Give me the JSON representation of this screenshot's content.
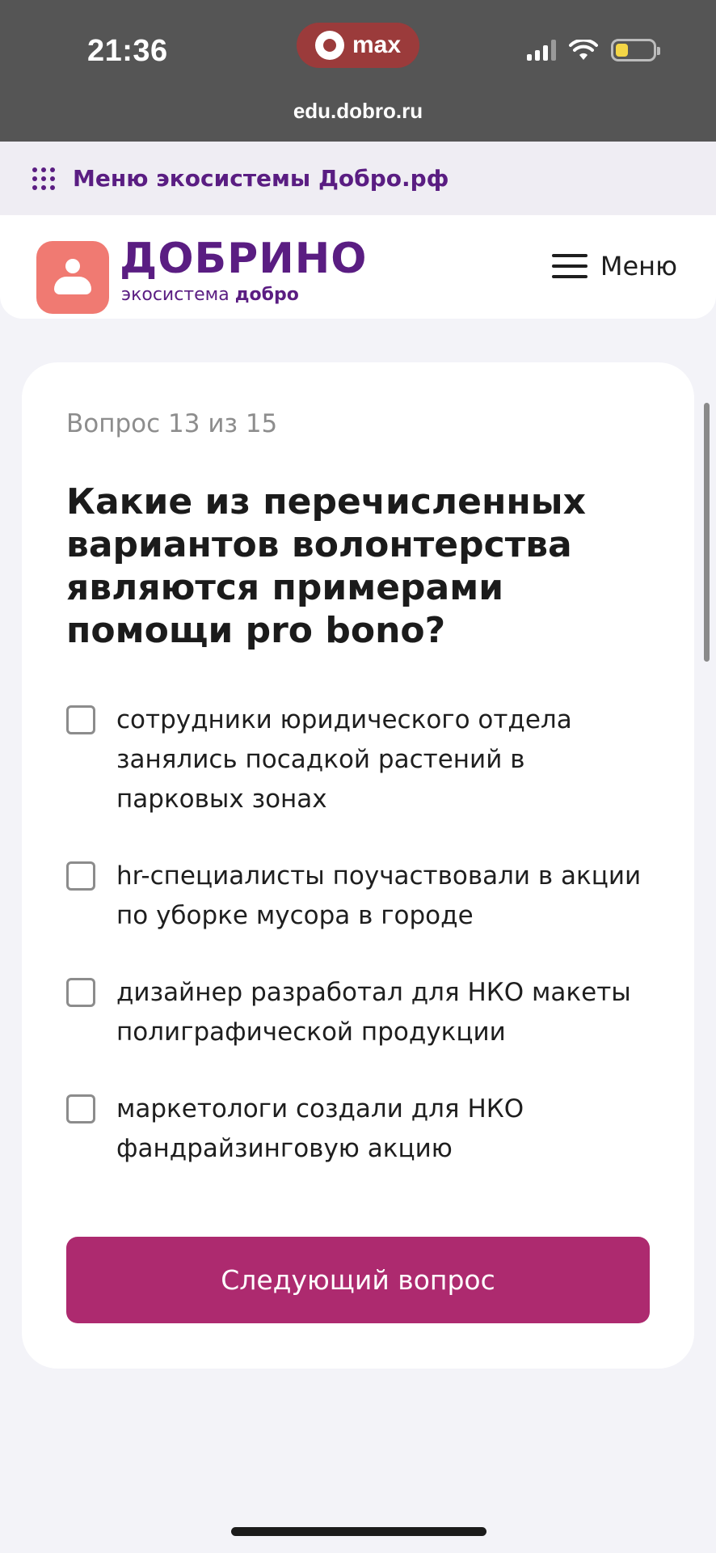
{
  "status_bar": {
    "time": "21:36",
    "app_pill": "max",
    "icons": [
      "signal-icon",
      "wifi-icon",
      "battery-icon"
    ],
    "battery_level": 0.35
  },
  "browser": {
    "url": "edu.dobro.ru"
  },
  "eco_menu": {
    "label": "Меню экосистемы Добро.рф",
    "icon": "grid-dots-icon"
  },
  "header": {
    "brand": "ДОБРИНО",
    "subtitle_prefix": "экосистема ",
    "subtitle_brand": "добро",
    "menu_label": "Меню"
  },
  "quiz": {
    "counter": "Вопрос 13 из 15",
    "question": "Какие из перечисленных вариантов волонтерства являются примерами помощи pro bono?",
    "options": [
      {
        "text": "сотрудники юридического отдела занялись посадкой растений в парковых зонах",
        "checked": false
      },
      {
        "text": "hr-специалисты поучаствовали в акции по уборке мусора в городе",
        "checked": false
      },
      {
        "text": "дизайнер разработал для НКО макеты полиграфической продукции",
        "checked": false
      },
      {
        "text": "маркетологи создали для НКО фандрайзинговую акцию",
        "checked": false
      }
    ],
    "next_button": "Следующий вопрос"
  },
  "colors": {
    "brand_purple": "#5a1d82",
    "logo_coral": "#f07a72",
    "button_magenta": "#ad2a6f",
    "status_bg": "#555555"
  }
}
